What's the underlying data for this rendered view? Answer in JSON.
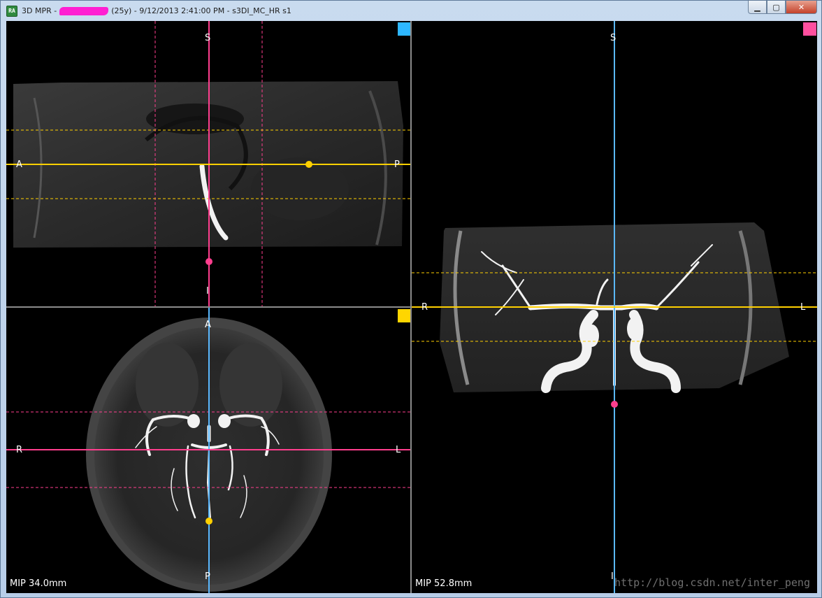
{
  "window": {
    "icon_label": "RA",
    "title_prefix": "3D MPR -",
    "title_suffix": "(25y) - 9/12/2013 2:41:00 PM - s3DI_MC_HR s1",
    "minimize_glyph": "▁",
    "maximize_glyph": "▢",
    "close_glyph": "✕"
  },
  "colors": {
    "sagittal_accent": "#2eb7ff",
    "coronal_accent": "#ff4f9f",
    "axial_accent": "#ffd600",
    "crosshair_pink": "#ff3e8e",
    "crosshair_yellow": "#ffd000",
    "crosshair_blue": "#5ab8ff"
  },
  "panes": {
    "sagittal": {
      "top": "S",
      "bottom": "I",
      "left": "A",
      "right": "P"
    },
    "axial": {
      "top": "A",
      "bottom": "P",
      "left": "R",
      "right": "L",
      "mip": "MIP 34.0mm"
    },
    "coronal": {
      "top": "S",
      "bottom": "I",
      "left": "R",
      "right": "L",
      "mip": "MIP 52.8mm"
    }
  },
  "watermark": "http://blog.csdn.net/inter_peng"
}
